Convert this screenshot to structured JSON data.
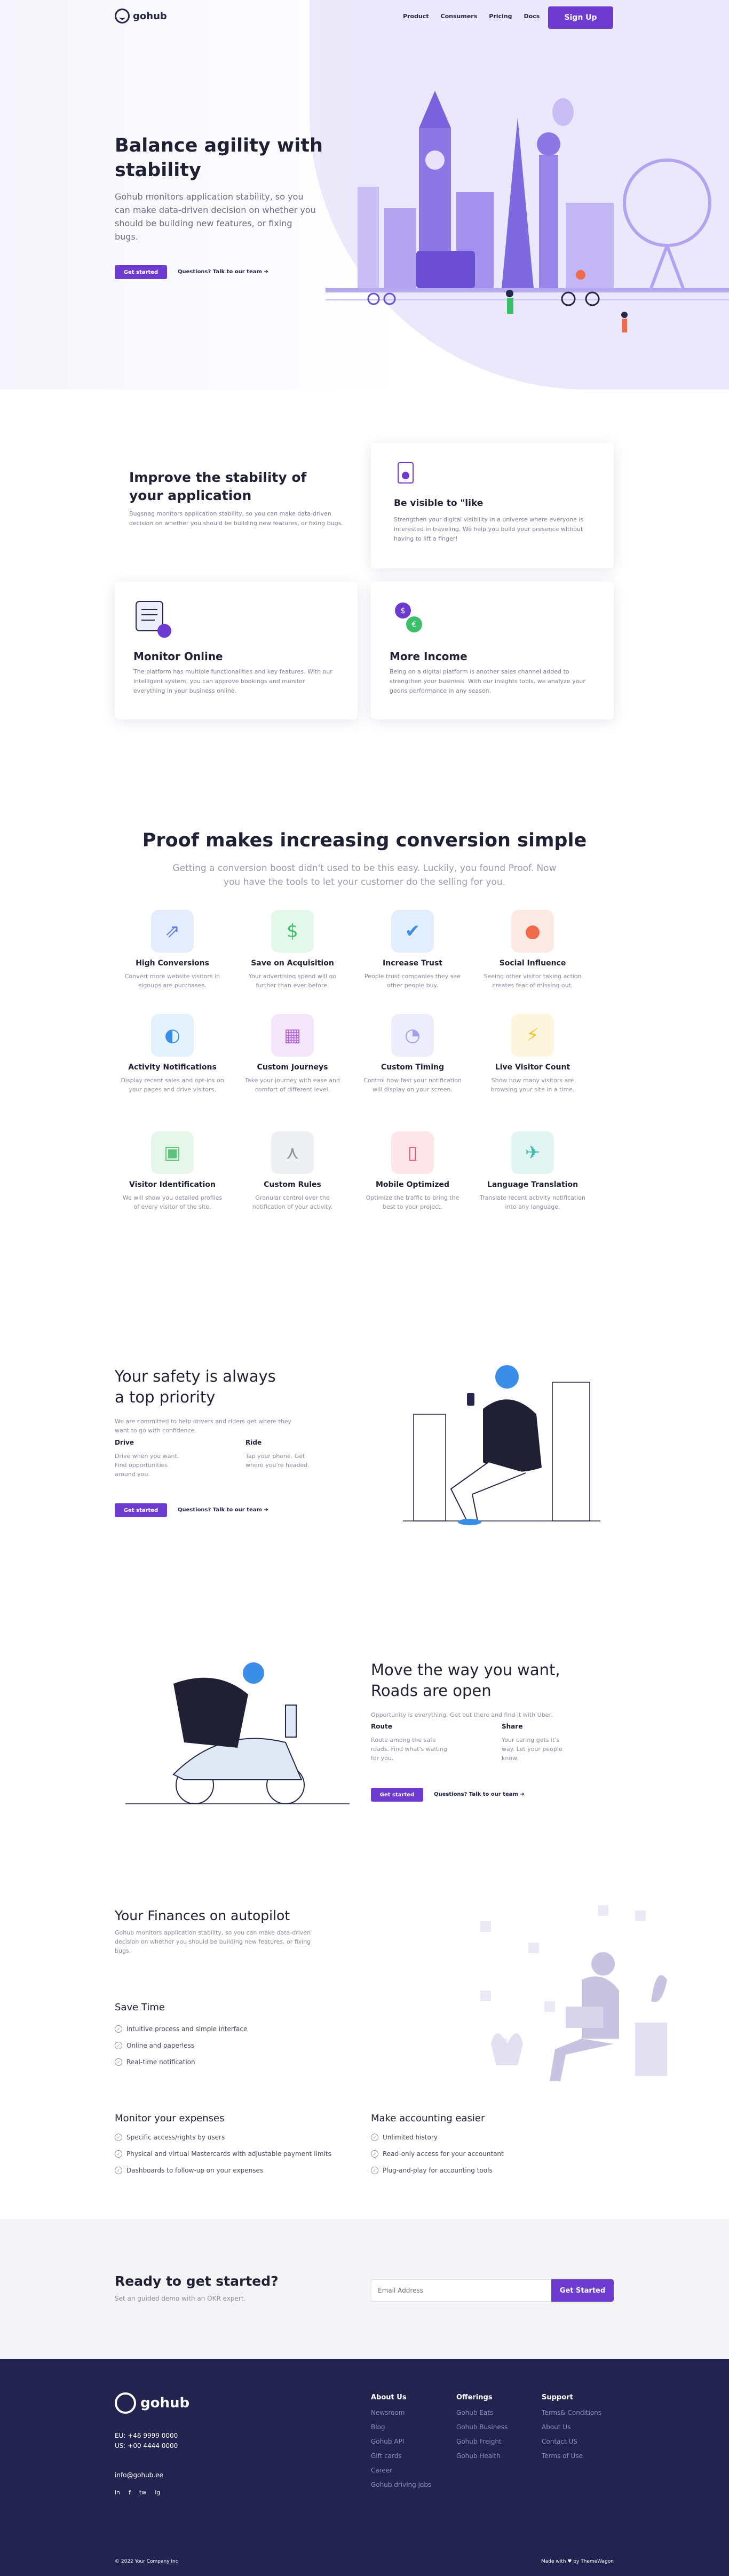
{
  "nav": {
    "logo": "gohub",
    "items": [
      "Product",
      "Consumers",
      "Pricing",
      "Docs"
    ],
    "signup": "Sign Up"
  },
  "hero": {
    "title": "Balance agility with stability",
    "body": "Gohub monitors application stability, so you can make data-driven decision on whether you should be building new features, or fixing bugs.",
    "cta": "Get started",
    "link": "Questions? Talk to our team  ➜"
  },
  "cards": [
    {
      "title": "Improve the stability of your application",
      "body": "Bugsnag monitors application stability, so you can make data-driven decision on whether you should be building new features, or fixing bugs."
    },
    {
      "title": "Be visible to \"like",
      "body": "Strengthen your digital visibility in a universe where everyone is interested in traveling. We help you build your presence without having to lift a finger!"
    },
    {
      "title": "Monitor Online",
      "body": "The platform has multiple functionalities and key features. With our intelligent system, you can approve bookings and monitor everything in your business online."
    },
    {
      "title": "More Income",
      "body": "Being on a digital platform is another sales channel added to strengthen your business. With our insights tools, we analyze your geons performance in any season."
    }
  ],
  "proof": {
    "title": "Proof makes increasing conversion simple",
    "sub": "Getting a conversion boost didn't used to be this easy. Luckily, you found Proof. Now you have the tools to let your customer do the selling for you."
  },
  "features": [
    {
      "title": "High Conversions",
      "body": "Convert more website visitors in signups are purchases.",
      "icon": "arrows-icon",
      "bg": "#e5edfd",
      "fg": "#5a7fe6"
    },
    {
      "title": "Save on Acquisition",
      "body": "Your advertising spend will go further than ever before.",
      "icon": "dollar-icon",
      "bg": "#e3f7ea",
      "fg": "#3cbf6a"
    },
    {
      "title": "Increase Trust",
      "body": "People trust companies they see other people buy.",
      "icon": "check-icon",
      "bg": "#e3eefc",
      "fg": "#3a8ee8"
    },
    {
      "title": "Social Influence",
      "body": "Seeing other visitor taking action creates fear of missing out.",
      "icon": "person-icon",
      "bg": "#fde9e4",
      "fg": "#f06a4c"
    },
    {
      "title": "Activity Notifications",
      "body": "Display recent sales and opt-ins on your pages and drive visitors.",
      "icon": "toggle-icon",
      "bg": "#e3f1fc",
      "fg": "#3a8ee8"
    },
    {
      "title": "Custom Journeys",
      "body": "Take your journey with ease and comfort of different level.",
      "icon": "map-icon",
      "bg": "#f3e6f8",
      "fg": "#b86ad6"
    },
    {
      "title": "Custom Timing",
      "body": "Control how fast your notification will display on your screen.",
      "icon": "timer-icon",
      "bg": "#eeedfb",
      "fg": "#a79ef0"
    },
    {
      "title": "Live Visitor Count",
      "body": "Show how many visitors are browsing your site in a time.",
      "icon": "bolt-icon",
      "bg": "#fdf6dd",
      "fg": "#f2c12e"
    },
    {
      "title": "Visitor Identification",
      "body": "We will show you detailed profiles of every visitor of the site.",
      "icon": "badge-icon",
      "bg": "#e6f6ea",
      "fg": "#5cc47a"
    },
    {
      "title": "Custom Rules",
      "body": "Granular control over the notification of your activity.",
      "icon": "split-icon",
      "bg": "#eeeff2",
      "fg": "#8e9099"
    },
    {
      "title": "Mobile Optimized",
      "body": "Optimize the traffic to bring the best to your project.",
      "icon": "phone-icon",
      "bg": "#fde6ea",
      "fg": "#ee5a73"
    },
    {
      "title": "Language Translation",
      "body": "Translate recent activity notification into any language.",
      "icon": "plane-icon",
      "bg": "#e2f5f2",
      "fg": "#3fb9a7"
    }
  ],
  "safety": {
    "title": "Your safety is always a top priority",
    "body": "We are committed to help drivers and riders get where they want to go with confidence.",
    "cols": [
      {
        "h": "Drive",
        "p": "Drive when you want. Find opportunities around you."
      },
      {
        "h": "Ride",
        "p": "Tap your phone. Get where you're headed."
      }
    ],
    "cta": "Get started",
    "link": "Questions? Talk to our team  ➜"
  },
  "move": {
    "title": "Move the way you want, Roads are open",
    "body": "Opportunity is everything. Get out there and find it with Uber.",
    "cols": [
      {
        "h": "Route",
        "p": "Route among the safe roads. Find what's waiting for you."
      },
      {
        "h": "Share",
        "p": "Your caring gets it's way. Let your people know."
      }
    ],
    "cta": "Get started",
    "link": "Questions? Talk to our team  ➜"
  },
  "finance": {
    "title": "Your Finances on autopilot",
    "body": "Gohub monitors application stability, so you can make data-driven decision on whether you should be building new features, or fixing bugs.",
    "save_title": "Save Time",
    "save_items": [
      "Intuitive process and simple interface",
      "Online and paperless",
      "Real-time notification"
    ],
    "monitor_title": "Monitor your expenses",
    "monitor_items": [
      "Specific access/rights by users",
      "Physical and virtual Mastercards with adjustable payment limits",
      "Dashboards to follow-up on your expenses"
    ],
    "accounting_title": "Make accounting easier",
    "accounting_items": [
      "Unlimited history",
      "Read-only access for your accountant",
      "Plug-and-play for accounting tools"
    ]
  },
  "cta": {
    "title": "Ready to get started?",
    "sub": "Set an guided demo with an OKR expert.",
    "placeholder": "Email Address",
    "button": "Get Started"
  },
  "footer": {
    "logo": "gohub",
    "phone_eu": "EU: +46 9999 0000",
    "phone_us": "US: +00 4444 0000",
    "email": "info@gohub.ee",
    "social": [
      "in",
      "f",
      "tw",
      "ig"
    ],
    "cols": [
      {
        "h": "About Us",
        "links": [
          "Newsroom",
          "Blog",
          "Gohub API",
          "Gift cards",
          "Career",
          "Gohub driving jobs"
        ]
      },
      {
        "h": "Offerings",
        "links": [
          "Gohub Eats",
          "Gohub Business",
          "Gohub Freight",
          "Gohub Health"
        ]
      },
      {
        "h": "Support",
        "links": [
          "Terms& Conditions",
          "About Us",
          "Contact US",
          "Terms of Use"
        ]
      }
    ],
    "copyright": "© 2022 Your Company Inc",
    "credit": "Made with ♥ by ThemeWagon"
  }
}
